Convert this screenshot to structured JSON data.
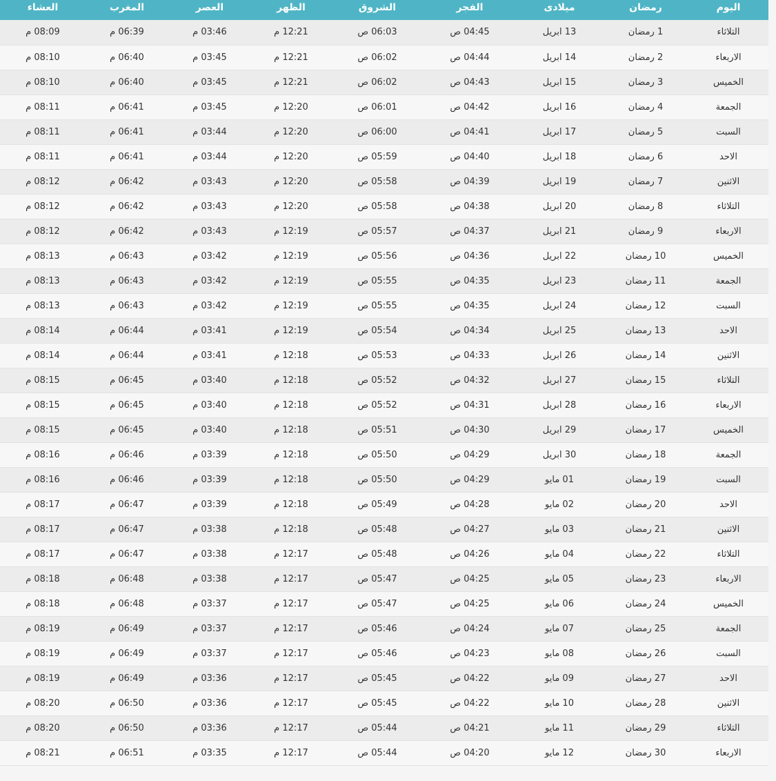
{
  "table": {
    "headers": {
      "day": "اليوم",
      "ramadan": "رمضان",
      "miladi": "ميلادى",
      "fajr": "الفجر",
      "shuruq": "الشروق",
      "zuhr": "الظهر",
      "asr": "العصر",
      "maghrib": "المغرب",
      "isha": "العشاء"
    },
    "rows": [
      {
        "day": "التلاثاء",
        "ramadan": "1 رمضان",
        "miladi": "13 ابريل",
        "fajr": "04:45 ص",
        "shuruq": "06:03 ص",
        "zuhr": "12:21 م",
        "asr": "03:46 م",
        "maghrib": "06:39 م",
        "isha": "08:09 م"
      },
      {
        "day": "الاربعاء",
        "ramadan": "2 رمضان",
        "miladi": "14 ابريل",
        "fajr": "04:44 ص",
        "shuruq": "06:02 ص",
        "zuhr": "12:21 م",
        "asr": "03:45 م",
        "maghrib": "06:40 م",
        "isha": "08:10 م"
      },
      {
        "day": "الخميس",
        "ramadan": "3 رمضان",
        "miladi": "15 ابريل",
        "fajr": "04:43 ص",
        "shuruq": "06:02 ص",
        "zuhr": "12:21 م",
        "asr": "03:45 م",
        "maghrib": "06:40 م",
        "isha": "08:10 م"
      },
      {
        "day": "الجمعة",
        "ramadan": "4 رمضان",
        "miladi": "16 ابريل",
        "fajr": "04:42 ص",
        "shuruq": "06:01 ص",
        "zuhr": "12:20 م",
        "asr": "03:45 م",
        "maghrib": "06:41 م",
        "isha": "08:11 م"
      },
      {
        "day": "السبت",
        "ramadan": "5 رمضان",
        "miladi": "17 ابريل",
        "fajr": "04:41 ص",
        "shuruq": "06:00 ص",
        "zuhr": "12:20 م",
        "asr": "03:44 م",
        "maghrib": "06:41 م",
        "isha": "08:11 م"
      },
      {
        "day": "الاحد",
        "ramadan": "6 رمضان",
        "miladi": "18 ابريل",
        "fajr": "04:40 ص",
        "shuruq": "05:59 ص",
        "zuhr": "12:20 م",
        "asr": "03:44 م",
        "maghrib": "06:41 م",
        "isha": "08:11 م"
      },
      {
        "day": "الاثنين",
        "ramadan": "7 رمضان",
        "miladi": "19 ابريل",
        "fajr": "04:39 ص",
        "shuruq": "05:58 ص",
        "zuhr": "12:20 م",
        "asr": "03:43 م",
        "maghrib": "06:42 م",
        "isha": "08:12 م"
      },
      {
        "day": "التلاثاء",
        "ramadan": "8 رمضان",
        "miladi": "20 ابريل",
        "fajr": "04:38 ص",
        "shuruq": "05:58 ص",
        "zuhr": "12:20 م",
        "asr": "03:43 م",
        "maghrib": "06:42 م",
        "isha": "08:12 م"
      },
      {
        "day": "الاربعاء",
        "ramadan": "9 رمضان",
        "miladi": "21 ابريل",
        "fajr": "04:37 ص",
        "shuruq": "05:57 ص",
        "zuhr": "12:19 م",
        "asr": "03:43 م",
        "maghrib": "06:42 م",
        "isha": "08:12 م"
      },
      {
        "day": "الخميس",
        "ramadan": "10 رمضان",
        "miladi": "22 ابريل",
        "fajr": "04:36 ص",
        "shuruq": "05:56 ص",
        "zuhr": "12:19 م",
        "asr": "03:42 م",
        "maghrib": "06:43 م",
        "isha": "08:13 م"
      },
      {
        "day": "الجمعة",
        "ramadan": "11 رمضان",
        "miladi": "23 ابريل",
        "fajr": "04:35 ص",
        "shuruq": "05:55 ص",
        "zuhr": "12:19 م",
        "asr": "03:42 م",
        "maghrib": "06:43 م",
        "isha": "08:13 م"
      },
      {
        "day": "السبت",
        "ramadan": "12 رمضان",
        "miladi": "24 ابريل",
        "fajr": "04:35 ص",
        "shuruq": "05:55 ص",
        "zuhr": "12:19 م",
        "asr": "03:42 م",
        "maghrib": "06:43 م",
        "isha": "08:13 م"
      },
      {
        "day": "الاحد",
        "ramadan": "13 رمضان",
        "miladi": "25 ابريل",
        "fajr": "04:34 ص",
        "shuruq": "05:54 ص",
        "zuhr": "12:19 م",
        "asr": "03:41 م",
        "maghrib": "06:44 م",
        "isha": "08:14 م"
      },
      {
        "day": "الاثنين",
        "ramadan": "14 رمضان",
        "miladi": "26 ابريل",
        "fajr": "04:33 ص",
        "shuruq": "05:53 ص",
        "zuhr": "12:18 م",
        "asr": "03:41 م",
        "maghrib": "06:44 م",
        "isha": "08:14 م"
      },
      {
        "day": "التلاثاء",
        "ramadan": "15 رمضان",
        "miladi": "27 ابريل",
        "fajr": "04:32 ص",
        "shuruq": "05:52 ص",
        "zuhr": "12:18 م",
        "asr": "03:40 م",
        "maghrib": "06:45 م",
        "isha": "08:15 م"
      },
      {
        "day": "الاربعاء",
        "ramadan": "16 رمضان",
        "miladi": "28 ابريل",
        "fajr": "04:31 ص",
        "shuruq": "05:52 ص",
        "zuhr": "12:18 م",
        "asr": "03:40 م",
        "maghrib": "06:45 م",
        "isha": "08:15 م"
      },
      {
        "day": "الخميس",
        "ramadan": "17 رمضان",
        "miladi": "29 ابريل",
        "fajr": "04:30 ص",
        "shuruq": "05:51 ص",
        "zuhr": "12:18 م",
        "asr": "03:40 م",
        "maghrib": "06:45 م",
        "isha": "08:15 م"
      },
      {
        "day": "الجمعة",
        "ramadan": "18 رمضان",
        "miladi": "30 ابريل",
        "fajr": "04:29 ص",
        "shuruq": "05:50 ص",
        "zuhr": "12:18 م",
        "asr": "03:39 م",
        "maghrib": "06:46 م",
        "isha": "08:16 م"
      },
      {
        "day": "السبت",
        "ramadan": "19 رمضان",
        "miladi": "01 مايو",
        "fajr": "04:29 ص",
        "shuruq": "05:50 ص",
        "zuhr": "12:18 م",
        "asr": "03:39 م",
        "maghrib": "06:46 م",
        "isha": "08:16 م"
      },
      {
        "day": "الاحد",
        "ramadan": "20 رمضان",
        "miladi": "02 مايو",
        "fajr": "04:28 ص",
        "shuruq": "05:49 ص",
        "zuhr": "12:18 م",
        "asr": "03:39 م",
        "maghrib": "06:47 م",
        "isha": "08:17 م"
      },
      {
        "day": "الاثنين",
        "ramadan": "21 رمضان",
        "miladi": "03 مايو",
        "fajr": "04:27 ص",
        "shuruq": "05:48 ص",
        "zuhr": "12:18 م",
        "asr": "03:38 م",
        "maghrib": "06:47 م",
        "isha": "08:17 م"
      },
      {
        "day": "التلاثاء",
        "ramadan": "22 رمضان",
        "miladi": "04 مايو",
        "fajr": "04:26 ص",
        "shuruq": "05:48 ص",
        "zuhr": "12:17 م",
        "asr": "03:38 م",
        "maghrib": "06:47 م",
        "isha": "08:17 م"
      },
      {
        "day": "الاربعاء",
        "ramadan": "23 رمضان",
        "miladi": "05 مايو",
        "fajr": "04:25 ص",
        "shuruq": "05:47 ص",
        "zuhr": "12:17 م",
        "asr": "03:38 م",
        "maghrib": "06:48 م",
        "isha": "08:18 م"
      },
      {
        "day": "الخميس",
        "ramadan": "24 رمضان",
        "miladi": "06 مايو",
        "fajr": "04:25 ص",
        "shuruq": "05:47 ص",
        "zuhr": "12:17 م",
        "asr": "03:37 م",
        "maghrib": "06:48 م",
        "isha": "08:18 م"
      },
      {
        "day": "الجمعة",
        "ramadan": "25 رمضان",
        "miladi": "07 مايو",
        "fajr": "04:24 ص",
        "shuruq": "05:46 ص",
        "zuhr": "12:17 م",
        "asr": "03:37 م",
        "maghrib": "06:49 م",
        "isha": "08:19 م"
      },
      {
        "day": "السبت",
        "ramadan": "26 رمضان",
        "miladi": "08 مايو",
        "fajr": "04:23 ص",
        "shuruq": "05:46 ص",
        "zuhr": "12:17 م",
        "asr": "03:37 م",
        "maghrib": "06:49 م",
        "isha": "08:19 م"
      },
      {
        "day": "الاحد",
        "ramadan": "27 رمضان",
        "miladi": "09 مايو",
        "fajr": "04:22 ص",
        "shuruq": "05:45 ص",
        "zuhr": "12:17 م",
        "asr": "03:36 م",
        "maghrib": "06:49 م",
        "isha": "08:19 م"
      },
      {
        "day": "الاثنين",
        "ramadan": "28 رمضان",
        "miladi": "10 مايو",
        "fajr": "04:22 ص",
        "shuruq": "05:45 ص",
        "zuhr": "12:17 م",
        "asr": "03:36 م",
        "maghrib": "06:50 م",
        "isha": "08:20 م"
      },
      {
        "day": "التلاثاء",
        "ramadan": "29 رمضان",
        "miladi": "11 مايو",
        "fajr": "04:21 ص",
        "shuruq": "05:44 ص",
        "zuhr": "12:17 م",
        "asr": "03:36 م",
        "maghrib": "06:50 م",
        "isha": "08:20 م"
      },
      {
        "day": "الاربعاء",
        "ramadan": "30 رمضان",
        "miladi": "12 مايو",
        "fajr": "04:20 ص",
        "shuruq": "05:44 ص",
        "zuhr": "12:17 م",
        "asr": "03:35 م",
        "maghrib": "06:51 م",
        "isha": "08:21 م"
      }
    ]
  },
  "colors": {
    "header_bg": "#4fb5c6",
    "row_odd": "#ececec",
    "row_even": "#f7f7f7",
    "text": "#333333"
  }
}
